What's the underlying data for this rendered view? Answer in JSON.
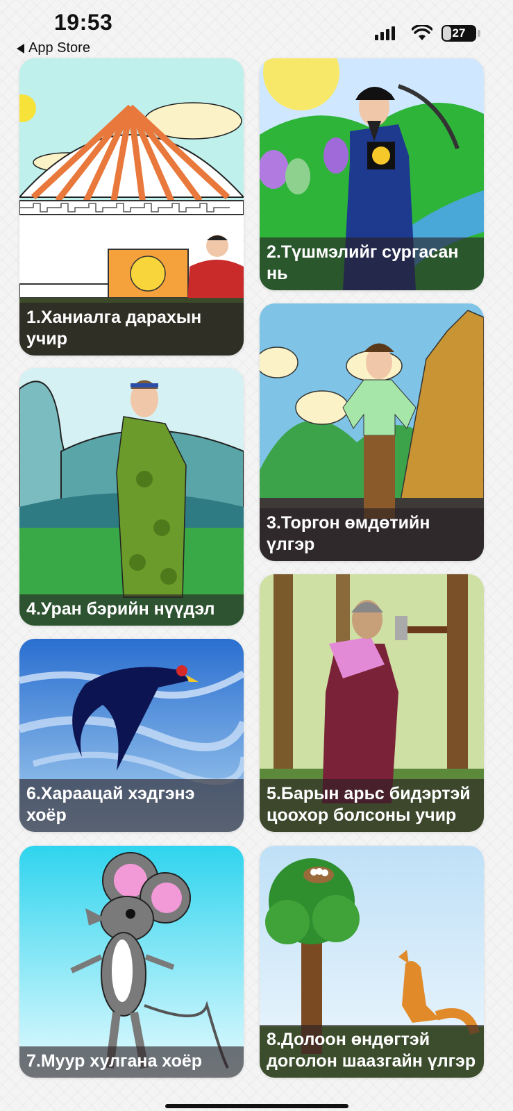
{
  "status_bar": {
    "time": "19:53",
    "back_label": "App Store",
    "battery_percent": "27",
    "battery_level": 0.27
  },
  "stories": [
    {
      "title": "1.Ханиалга дарахын учир",
      "icon": "ger-illustration"
    },
    {
      "title": "2.Түшмэлийг сургасан нь",
      "icon": "official-illustration"
    },
    {
      "title": "3.Торгон өмдөтийн үлгэр",
      "icon": "man-mountains-illustration"
    },
    {
      "title": "4.Уран бэрийн нүүдэл",
      "icon": "woman-deel-illustration"
    },
    {
      "title": "5.Барын арьс бидэртэй цоохор болсоны учир",
      "icon": "old-woman-axe-illustration"
    },
    {
      "title": "6.Хараацай хэдгэнэ хоёр",
      "icon": "swallow-illustration"
    },
    {
      "title": "7.Муур хулгана хоёр",
      "icon": "mouse-illustration"
    },
    {
      "title": "8.Долоон өндөгтэй доголон шаазгайн үлгэр",
      "icon": "tree-fox-illustration"
    }
  ]
}
